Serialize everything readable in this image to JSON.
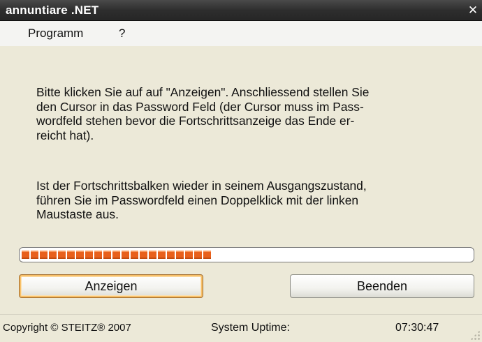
{
  "window": {
    "title": "annuntiare .NET",
    "close_glyph": "✕"
  },
  "menu": {
    "items": [
      "Programm",
      "?"
    ]
  },
  "instructions": {
    "para1_lines": [
      "Bitte klicken Sie auf auf \"Anzeigen\". Anschliessend stellen Sie",
      "den Cursor in das Password Feld (der Cursor muss im Pass-",
      "wordfeld stehen bevor die Fortschrittsanzeige das Ende er-",
      "reicht hat)."
    ],
    "para2_lines": [
      "Ist der Fortschrittsbalken wieder in seinem Ausgangszustand,",
      "führen Sie im Passwordfeld einen Doppelklick mit der linken",
      "Maustaste aus."
    ]
  },
  "progress": {
    "segments_filled": 21,
    "color": "#e8601c",
    "fraction": 0.49
  },
  "buttons": {
    "show_label": "Anzeigen",
    "exit_label": "Beenden"
  },
  "status": {
    "copyright": "Copyright © STEITZ® 2007",
    "uptime_label": "System Uptime:",
    "uptime_value": "07:30:47"
  },
  "colors": {
    "titlebar": "#2e2e2e",
    "accent_button_border": "#f8c068"
  }
}
